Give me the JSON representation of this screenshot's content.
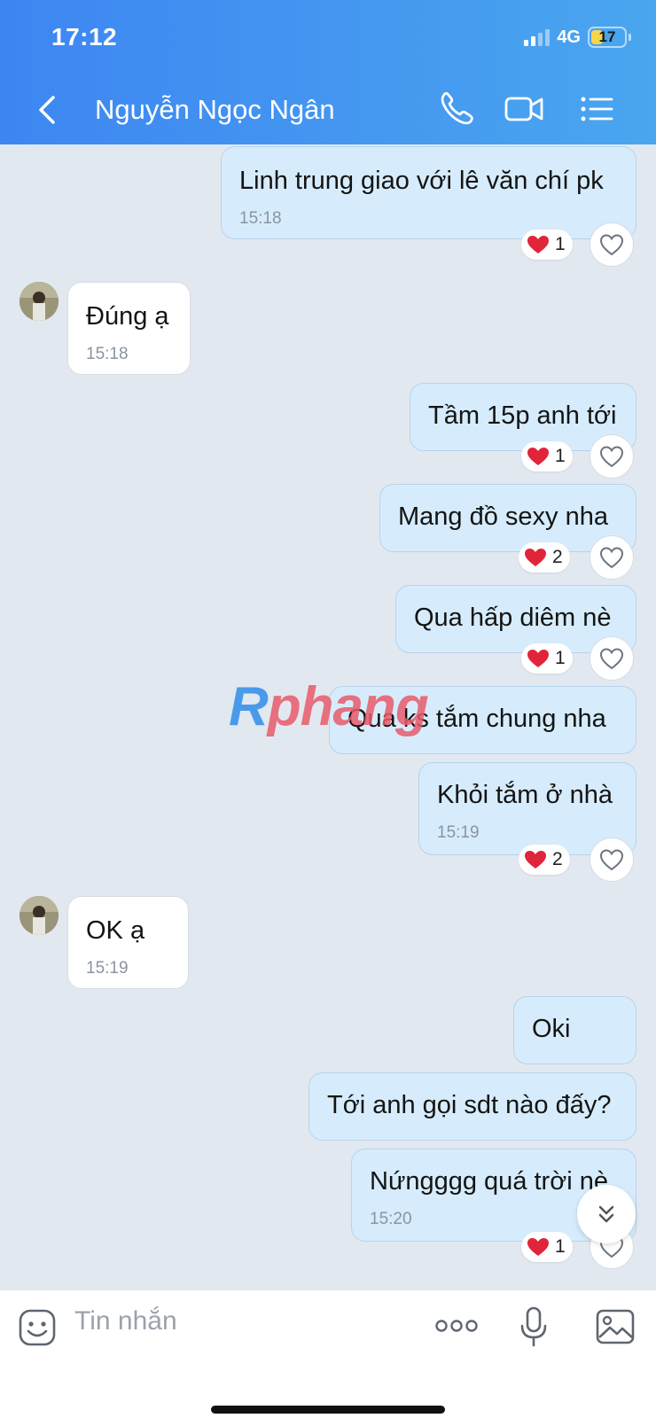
{
  "status_bar": {
    "time": "17:12",
    "network": "4G",
    "battery": "17"
  },
  "header": {
    "contact_name": "Nguyễn Ngọc Ngân"
  },
  "messages": [
    {
      "dir": "out",
      "text": "Linh trung giao với lê văn chí pk",
      "time": "15:18",
      "reaction_count": "1"
    },
    {
      "dir": "in",
      "text": "Đúng ạ",
      "time": "15:18"
    },
    {
      "dir": "out",
      "text": "Tầm 15p anh tới",
      "reaction_count": "1"
    },
    {
      "dir": "out",
      "text": "Mang đồ sexy nha",
      "reaction_count": "2"
    },
    {
      "dir": "out",
      "text": "Qua hấp diêm nè",
      "reaction_count": "1"
    },
    {
      "dir": "out",
      "text": "Qua ks tắm chung nha"
    },
    {
      "dir": "out",
      "text": "Khỏi tắm ở nhà",
      "time": "15:19",
      "reaction_count": "2"
    },
    {
      "dir": "in",
      "text": "OK ạ",
      "time": "15:19"
    },
    {
      "dir": "out",
      "text": "Oki"
    },
    {
      "dir": "out",
      "text": "Tới anh gọi sdt nào đấy?"
    },
    {
      "dir": "out",
      "text": "Nứngggg quá trời nè",
      "time": "15:20",
      "reaction_count": "1"
    }
  ],
  "watermark": {
    "part1": "R",
    "part2": "phang"
  },
  "input_bar": {
    "placeholder": "Tin nhắn"
  },
  "colors": {
    "header_start": "#3d86f2",
    "header_end": "#4aa6ef",
    "outgoing_bubble": "#d6ecfc",
    "incoming_bubble": "#ffffff",
    "chat_bg": "#e2e8f0",
    "reaction_heart": "#e0243a"
  }
}
